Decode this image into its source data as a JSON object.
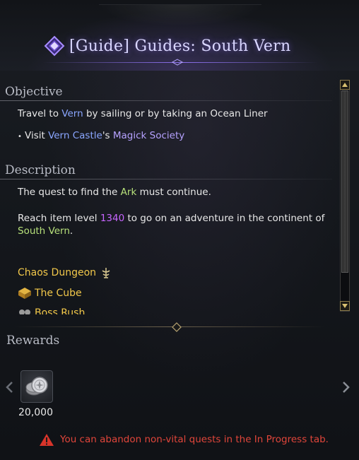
{
  "header": {
    "title": "[Guide] Guides: South Vern",
    "icon": "guide-diamond-icon"
  },
  "objective": {
    "title": "Objective",
    "line1": {
      "pre": "Travel to ",
      "place": "Vern",
      "post": " by sailing or by taking an Ocean Liner"
    },
    "line2": {
      "pre": "Visit ",
      "place": "Vern Castle",
      "mid": "'s ",
      "org": "Magick Society"
    }
  },
  "description": {
    "title": "Description",
    "para1": {
      "pre": "The quest to find the ",
      "ark": "Ark",
      "post": " must continue."
    },
    "para2": {
      "pre": "Reach item level ",
      "level": "1340",
      "post": " to go on an adventure in the continent of"
    },
    "para2_cont": {
      "place": "South Vern",
      "post": "."
    },
    "unlocks": [
      {
        "label": "Chaos Dungeon",
        "icon": "chaos-dungeon-icon"
      },
      {
        "label": "The Cube",
        "icon": "cube-icon"
      },
      {
        "label": "Boss Rush",
        "icon": "boss-rush-icon"
      }
    ]
  },
  "rewards": {
    "title": "Rewards",
    "items": [
      {
        "name": "silver-coins",
        "icon": "silver-coins-icon",
        "quantity": "20,000"
      }
    ],
    "prev_icon": "chevron-left-icon",
    "next_icon": "chevron-right-icon"
  },
  "warning": {
    "text": "You can abandon non-vital quests in the In Progress tab.",
    "icon": "warning-triangle-icon"
  },
  "colors": {
    "place": "#8aa6ff",
    "org": "#b6a2ff",
    "highlight_green": "#b6e07a",
    "level": "#c766ff",
    "unlock": "#f2c84a",
    "warning": "#e0453a"
  }
}
